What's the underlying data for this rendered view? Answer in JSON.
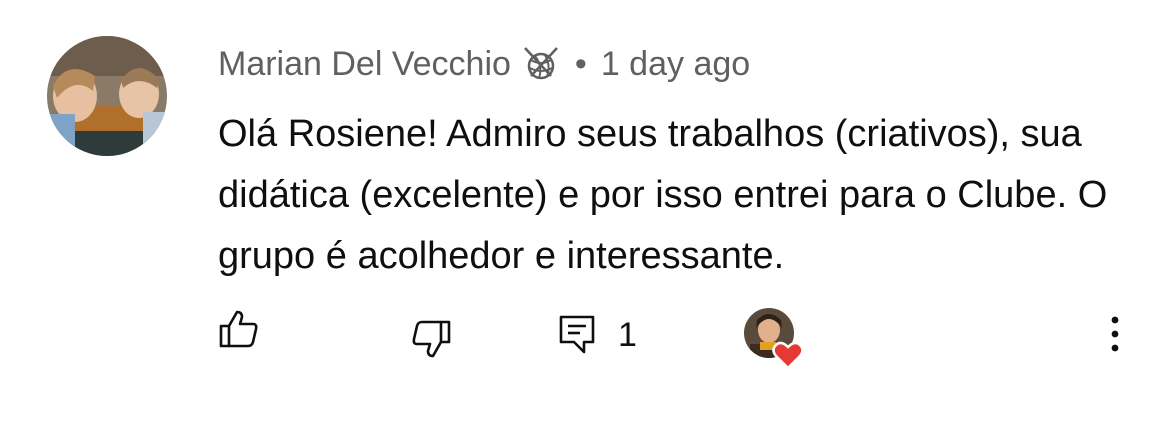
{
  "comment": {
    "author": "Marian Del Vecchio",
    "author_badge_icon": "yarn-ball-icon",
    "separator": "•",
    "time": "1 day ago",
    "text": "Olá Rosiene! Admiro seus trabalhos (criativos), sua didática (excelente) e por isso entrei para o Clube. O grupo é acolhedor e interessante.",
    "reply_count": "1"
  },
  "colors": {
    "meta_text": "#606060",
    "body_text": "#0f0f0f",
    "heart": "#e53935"
  }
}
